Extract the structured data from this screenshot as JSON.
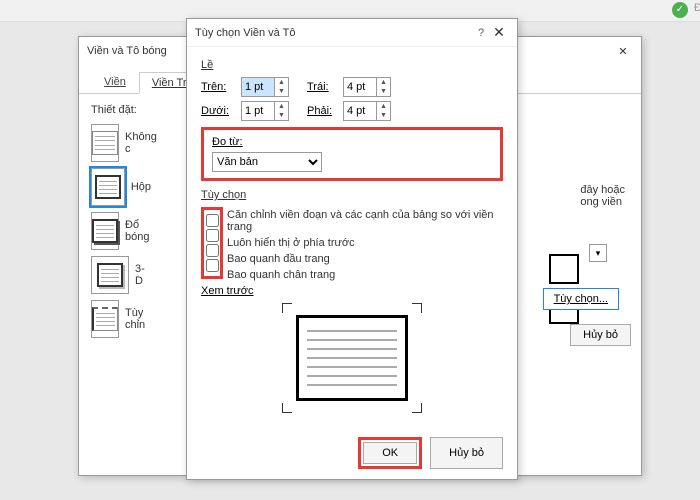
{
  "toolbar": {
    "status_d": "Đ"
  },
  "dialog1": {
    "title": "Viền và Tô bóng",
    "tab_vien": "Viền",
    "tab_vientr": "Viền Tr",
    "settings_label": "Thiết đặt:",
    "preset_none": "Không c",
    "preset_box": "Hộp",
    "preset_shadow": "Đổ bóng",
    "preset_3d": "3-D",
    "preset_custom": "Tùy chỉn",
    "right_text_1": "đây hoặc",
    "right_text_2": "ong viền",
    "options_btn": "Tùy chọn...",
    "cancel_btn": "Hủy bỏ"
  },
  "dialog2": {
    "title": "Tùy chọn Viền và Tô",
    "margins_label": "Lề",
    "top_label": "Trên:",
    "left_label": "Trái:",
    "bottom_label": "Dưới:",
    "right_label": "Phải:",
    "top_val": "1 pt",
    "left_val": "4 pt",
    "bottom_val": "1 pt",
    "right_val": "4 pt",
    "measure_label": "Đo từ:",
    "measure_value": "Văn bản",
    "options_label": "Tùy chọn",
    "opt1": "Căn chỉnh viền đoạn và các cạnh của bảng so với viền trang",
    "opt2": "Luôn hiển thị ở phía trước",
    "opt3": "Bao quanh đầu trang",
    "opt4": "Bao quanh chân trang",
    "preview_label": "Xem trước",
    "ok_btn": "OK",
    "cancel_btn": "Hủy bỏ"
  }
}
